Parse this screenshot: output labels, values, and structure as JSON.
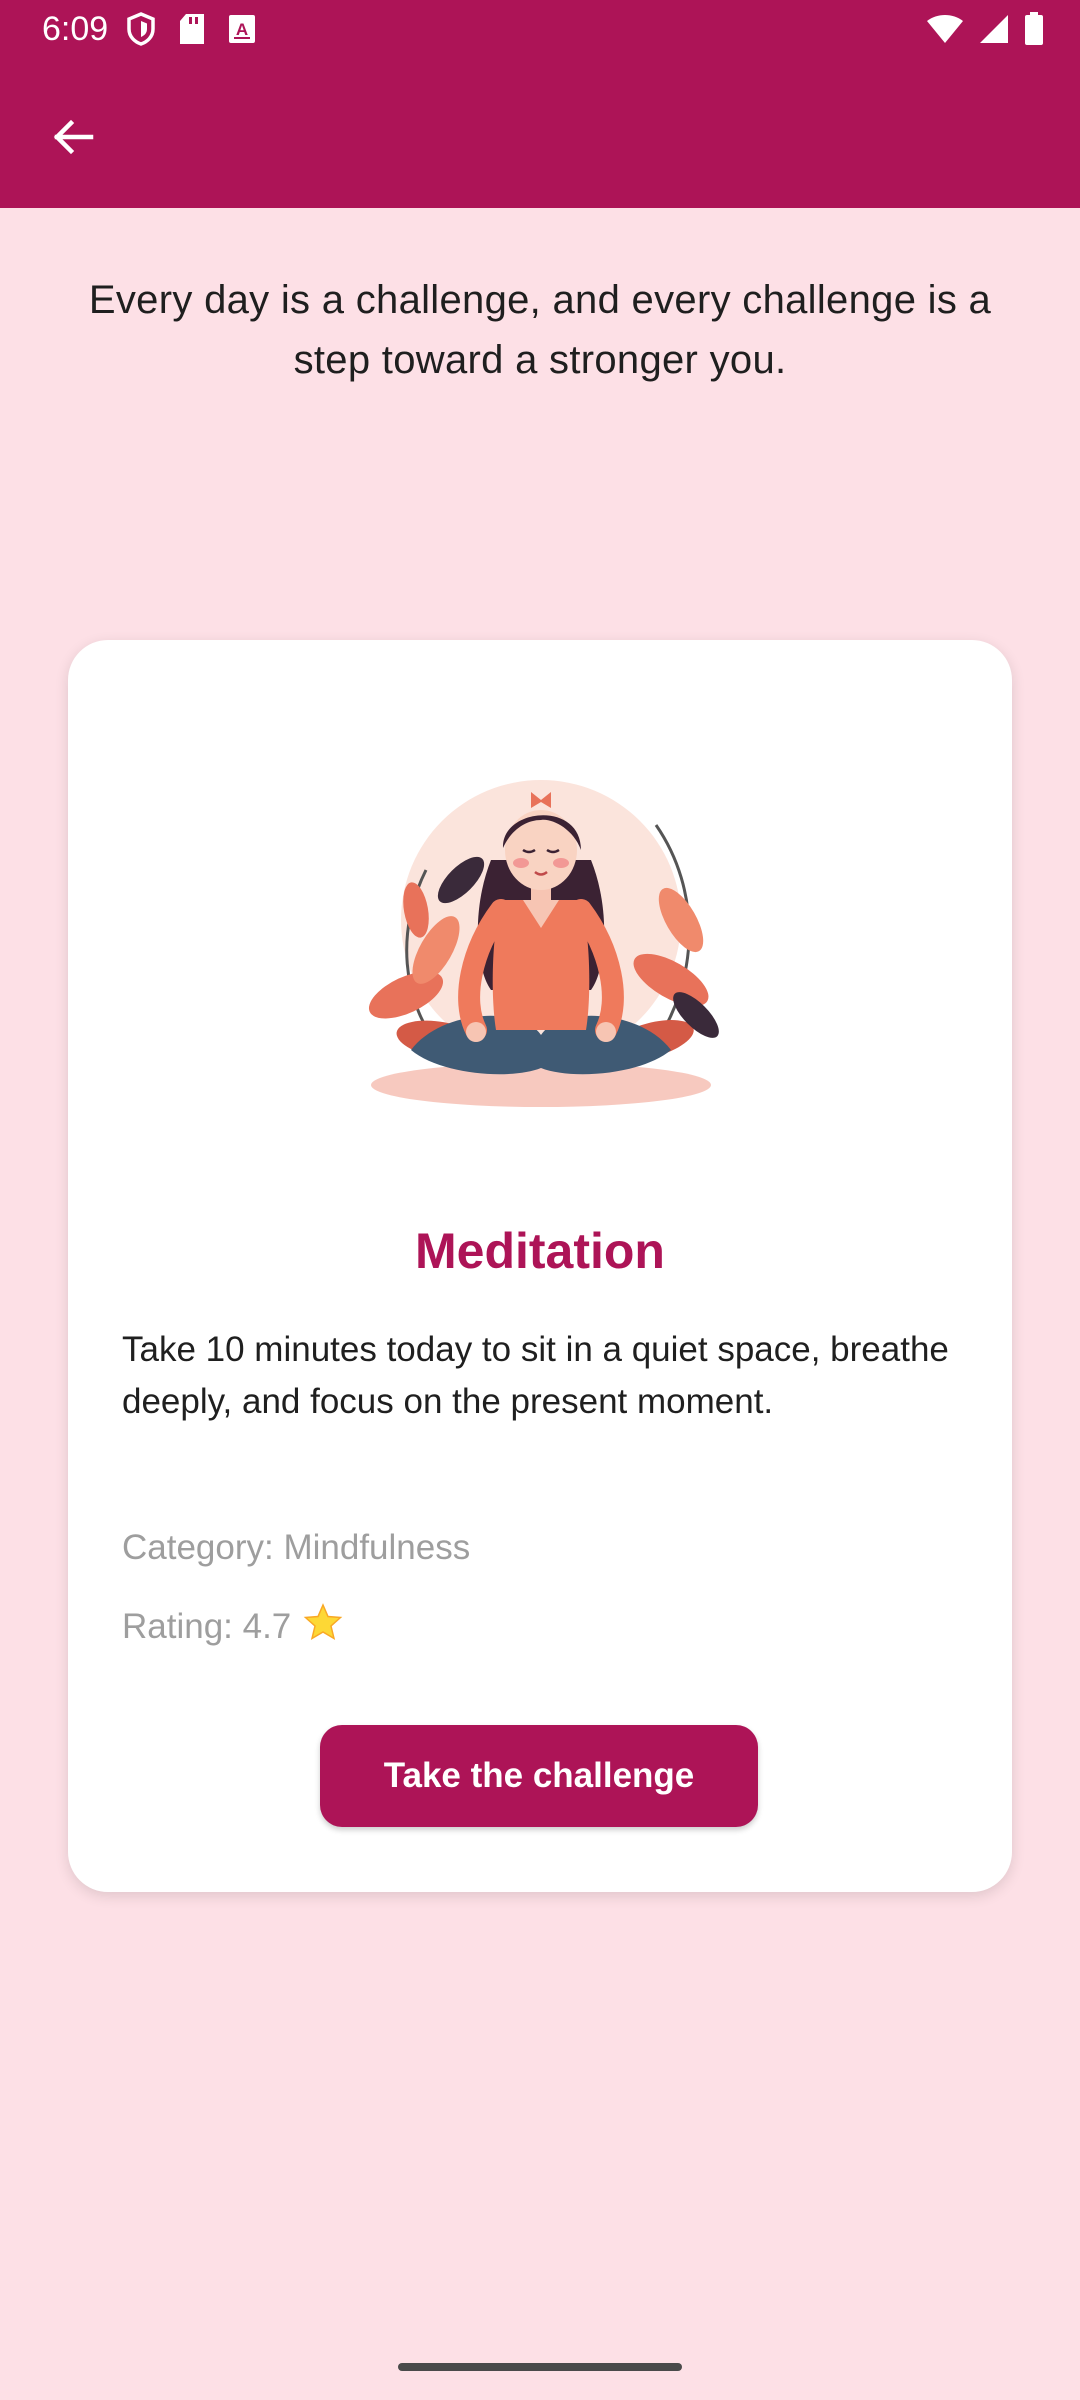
{
  "status_bar": {
    "time": "6:09",
    "left_icons": [
      "shield-icon",
      "sd-card-icon",
      "a-badge-icon"
    ],
    "right_icons": [
      "wifi-icon",
      "signal-icon",
      "battery-icon"
    ]
  },
  "app_bar": {
    "back_icon": "arrow-left-icon",
    "color": "#ad1457"
  },
  "quote": "Every day is a challenge, and every challenge is a step toward a stronger you.",
  "challenge": {
    "image": "meditation-illustration",
    "title": "Meditation",
    "description": "Take 10 minutes today to sit in a quiet space, breathe deeply, and focus on the present moment.",
    "category": "Category: Mindfulness",
    "rating": "Rating: 4.7",
    "rating_icon": "star-icon",
    "button_label": "Take the challenge"
  },
  "colors": {
    "primary": "#ad1457",
    "background": "#fde0e6",
    "card": "#ffffff"
  }
}
